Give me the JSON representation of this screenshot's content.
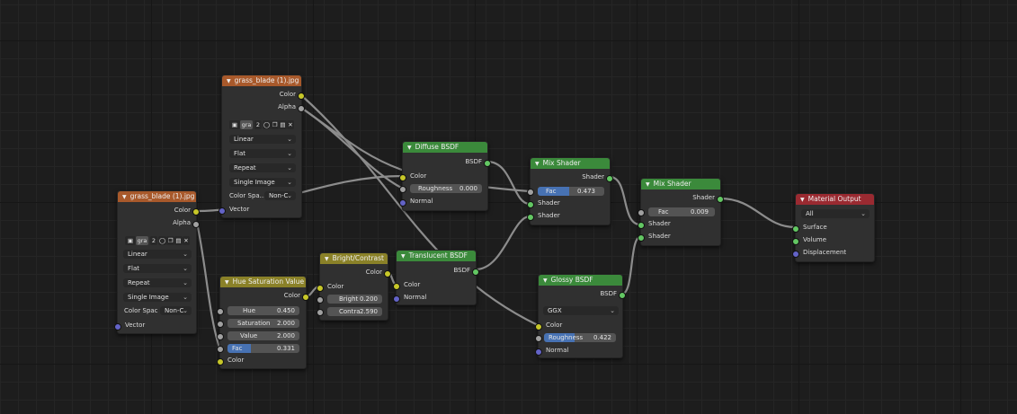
{
  "node_editor": {
    "nodes": {
      "img1": {
        "title": "grass_blade (1).jpg",
        "outputs": [
          "Color",
          "Alpha"
        ],
        "imgbar": {
          "name": "gra",
          "users": "2"
        },
        "interpolation": "Linear",
        "projection": "Flat",
        "extension": "Repeat",
        "source": "Single Image",
        "colorspace_label": "Color Spa...",
        "colorspace_value": "Non-C",
        "input": "Vector"
      },
      "img2": {
        "title": "grass_blade (1).jpg",
        "outputs": [
          "Color",
          "Alpha"
        ],
        "imgbar": {
          "name": "gra",
          "users": "2"
        },
        "interpolation": "Linear",
        "projection": "Flat",
        "extension": "Repeat",
        "source": "Single Image",
        "colorspace_label": "Color Spac",
        "colorspace_value": "Non-C",
        "input": "Vector"
      },
      "hsv": {
        "title": "Hue Saturation Value",
        "output": "Color",
        "hue": {
          "label": "Hue",
          "value": "0.450"
        },
        "saturation": {
          "label": "Saturation",
          "value": "2.000"
        },
        "value": {
          "label": "Value",
          "value": "2.000"
        },
        "fac": {
          "label": "Fac",
          "value": "0.331",
          "fraction": 0.331
        },
        "input": "Color"
      },
      "bc": {
        "title": "Bright/Contrast",
        "output": "Color",
        "input": "Color",
        "bright": {
          "label": "Bright",
          "value": "0.200"
        },
        "contrast": {
          "label": "Contra",
          "value": "2.590"
        }
      },
      "diffuse": {
        "title": "Diffuse BSDF",
        "output": "BSDF",
        "color": "Color",
        "roughness": {
          "label": "Roughness",
          "value": "0.000"
        },
        "normal": "Normal"
      },
      "translucent": {
        "title": "Translucent BSDF",
        "output": "BSDF",
        "color": "Color",
        "normal": "Normal"
      },
      "mix1": {
        "title": "Mix Shader",
        "output": "Shader",
        "fac": {
          "label": "Fac",
          "value": "0.473",
          "fraction": 0.473
        },
        "shader1": "Shader",
        "shader2": "Shader"
      },
      "glossy": {
        "title": "Glossy BSDF",
        "output": "BSDF",
        "distribution": "GGX",
        "color": "Color",
        "roughness": {
          "label": "Roughness",
          "value": "0.422",
          "fraction": 0.422
        },
        "normal": "Normal"
      },
      "mix2": {
        "title": "Mix Shader",
        "output": "Shader",
        "fac": {
          "label": "Fac",
          "value": "0.009"
        },
        "shader1": "Shader",
        "shader2": "Shader"
      },
      "matout": {
        "title": "Material Output",
        "target": "All",
        "inputs": [
          "Surface",
          "Volume",
          "Displacement"
        ]
      }
    },
    "colors": {
      "image_header": "#a8592b",
      "color_header": "#8a8128",
      "shader_header": "#3b8a3b",
      "output_header": "#9a2a31",
      "field_fill": "#4772b3",
      "link": "#9c9c9c"
    }
  }
}
